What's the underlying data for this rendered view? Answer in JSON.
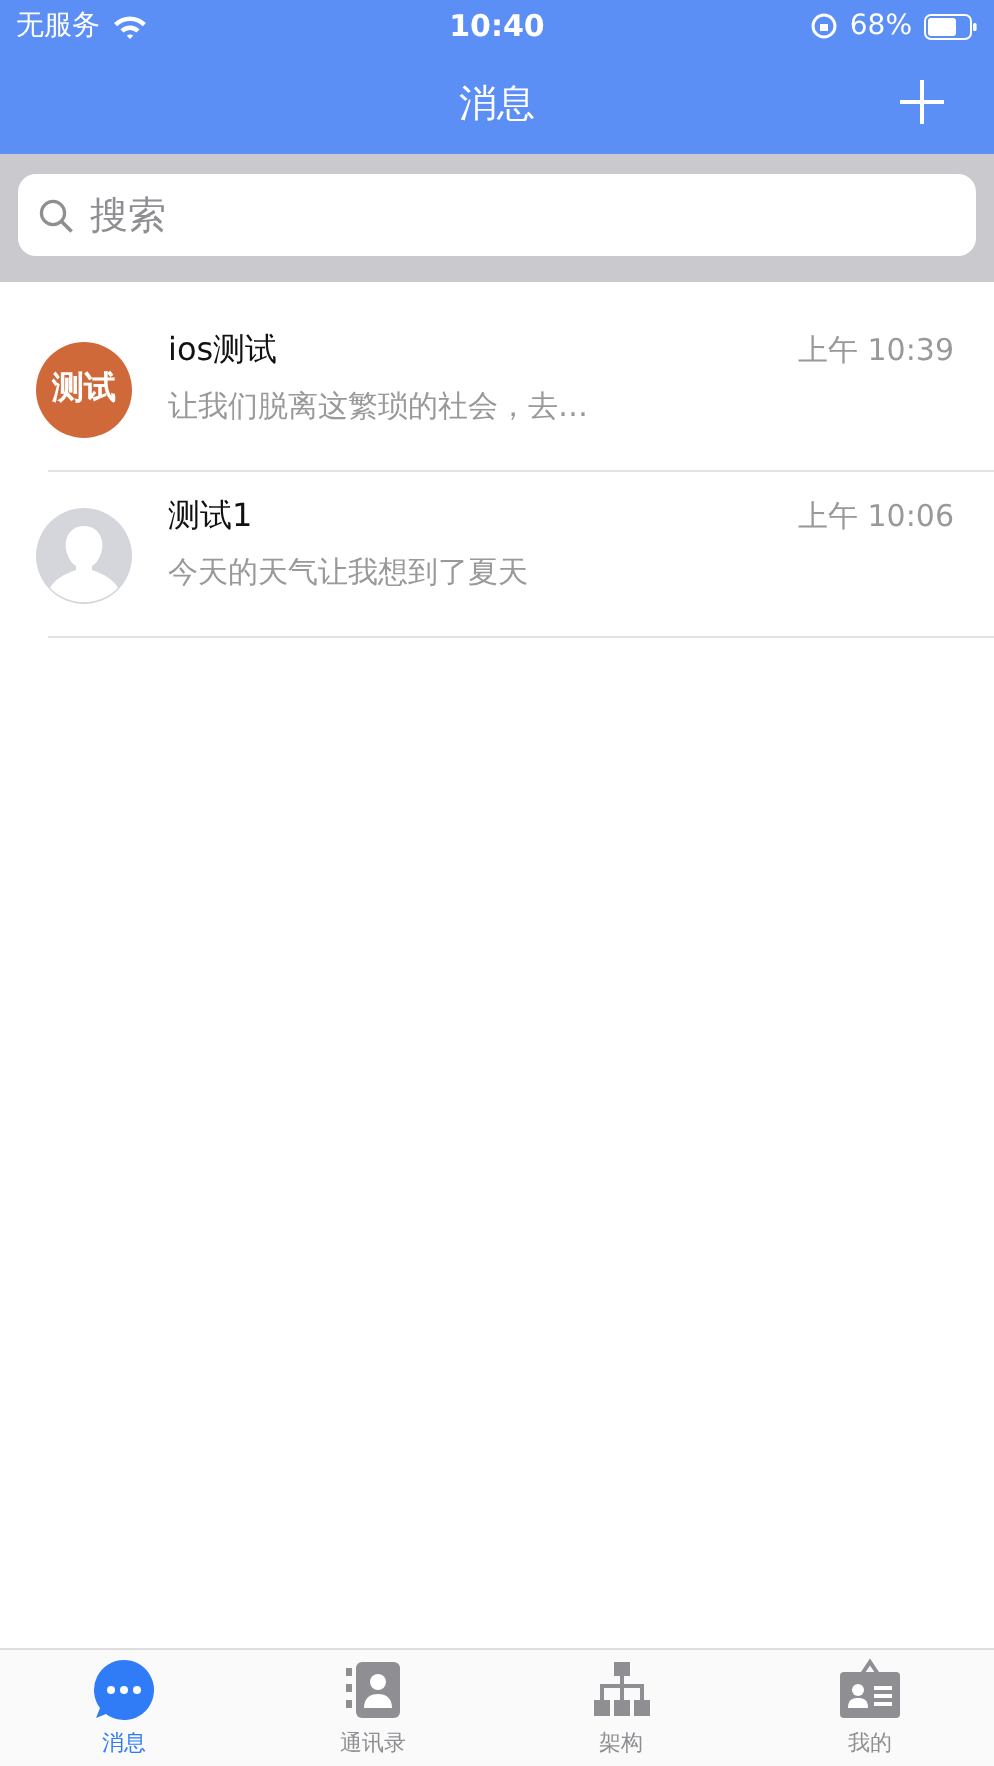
{
  "status_bar": {
    "carrier": "无服务",
    "time": "10:40",
    "battery": "68%"
  },
  "nav": {
    "title": "消息"
  },
  "search": {
    "placeholder": "搜索"
  },
  "conversations": [
    {
      "name": "ios测试",
      "preview": "让我们脱离这繁琐的社会，去…",
      "time": "上午 10:39",
      "avatar": {
        "kind": "text",
        "text": "测试",
        "color": "#d0693a"
      }
    },
    {
      "name": "测试1",
      "preview": "今天的天气让我想到了夏天",
      "time": "上午 10:06",
      "avatar": {
        "kind": "default"
      }
    }
  ],
  "tabs": [
    {
      "label": "消息",
      "kind": "chat",
      "selected": true
    },
    {
      "label": "通讯录",
      "kind": "contacts",
      "selected": false
    },
    {
      "label": "架构",
      "kind": "org",
      "selected": false
    },
    {
      "label": "我的",
      "kind": "badge",
      "selected": false
    }
  ]
}
